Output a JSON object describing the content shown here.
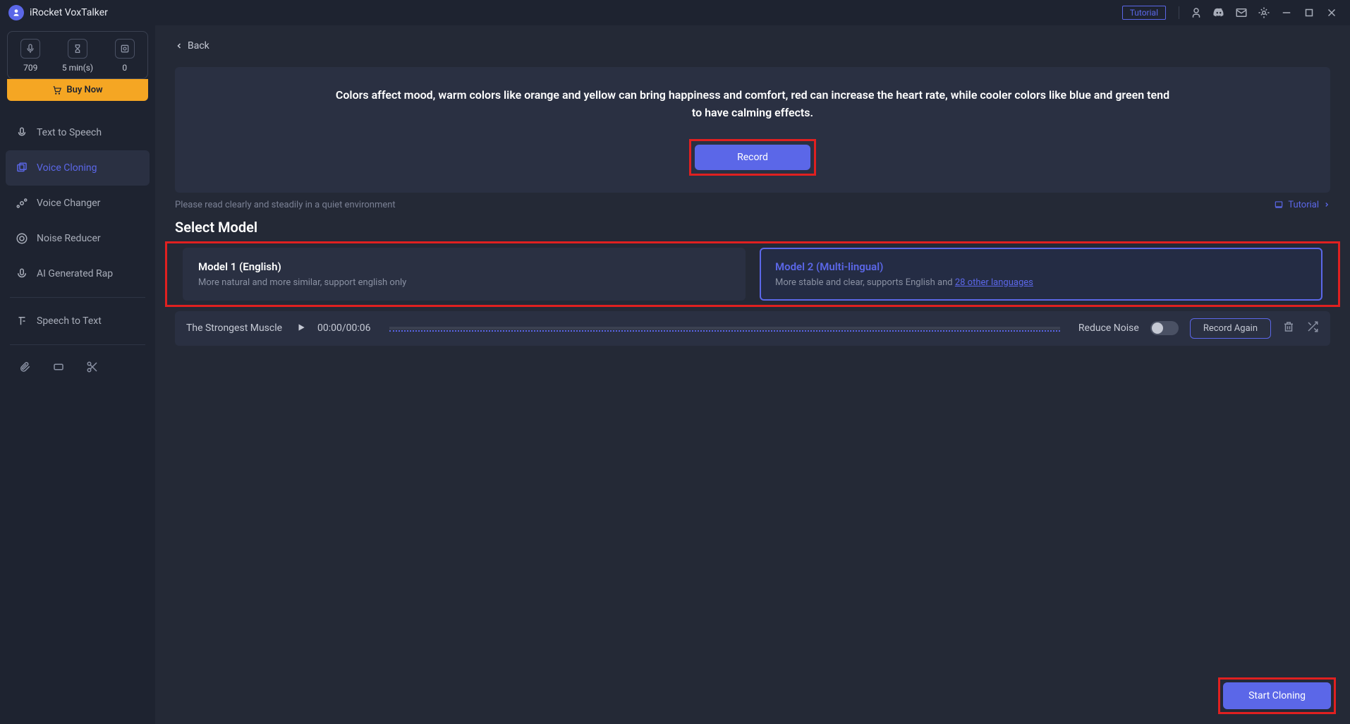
{
  "app": {
    "title": "iRocket VoxTalker",
    "tutorial_badge": "Tutorial"
  },
  "sidebar": {
    "credits": [
      {
        "value": "709"
      },
      {
        "value": "5 min(s)"
      },
      {
        "value": "0"
      }
    ],
    "buy_now": "Buy Now",
    "nav": [
      {
        "label": "Text to Speech"
      },
      {
        "label": "Voice Cloning"
      },
      {
        "label": "Voice Changer"
      },
      {
        "label": "Noise Reducer"
      },
      {
        "label": "AI Generated Rap"
      },
      {
        "label": "Speech to Text"
      }
    ]
  },
  "content": {
    "back": "Back",
    "prompt_text": "Colors affect mood, warm colors like orange and yellow can bring happiness and comfort, red can increase the heart rate, while cooler colors like blue and green tend to have calming effects.",
    "record": "Record",
    "hint": "Please read clearly and steadily in a quiet environment",
    "tutorial_link": "Tutorial",
    "section_title": "Select Model",
    "models": [
      {
        "title": "Model 1 (English)",
        "desc": "More natural and more similar, support english only"
      },
      {
        "title": "Model 2 (Multi-lingual)",
        "desc_prefix": "More stable and clear, supports English and ",
        "desc_link": "28 other languages"
      }
    ],
    "playback": {
      "track": "The Strongest Muscle",
      "time": "00:00/00:06",
      "reduce_noise": "Reduce Noise",
      "record_again": "Record Again"
    },
    "start_cloning": "Start Cloning"
  }
}
